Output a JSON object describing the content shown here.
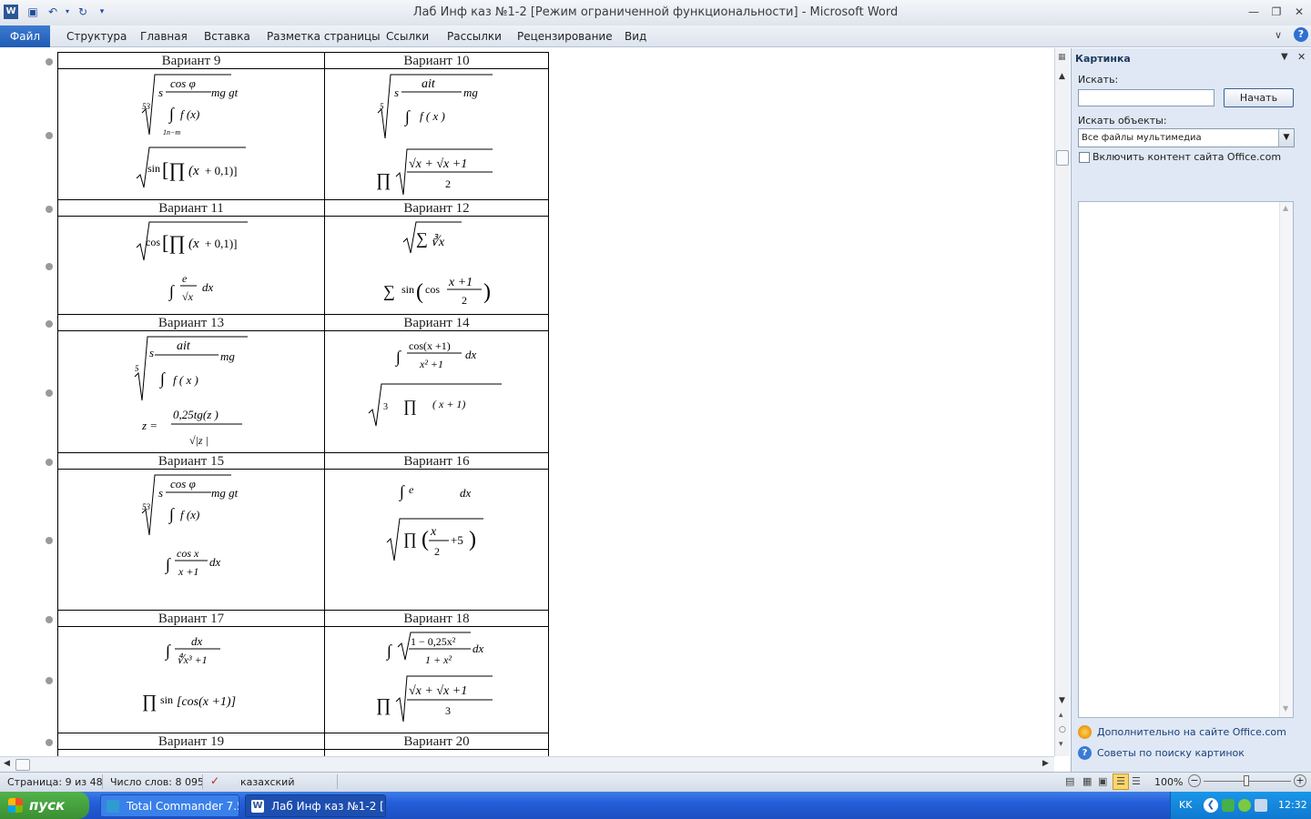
{
  "window": {
    "title": "Лаб Инф каз №1-2 [Режим ограниченной функциональности]  -  Microsoft Word",
    "app_icon": "word-icon"
  },
  "quick_access": [
    "save-icon",
    "undo-icon",
    "redo-icon",
    "customize-icon"
  ],
  "ribbon": {
    "file": "Файл",
    "tabs": [
      "Структура",
      "Главная",
      "Вставка",
      "Разметка страницы",
      "Ссылки",
      "Рассылки",
      "Рецензирование",
      "Вид"
    ]
  },
  "document": {
    "variants": [
      {
        "left": "Вариант   9",
        "right": "Вариант   10"
      },
      {
        "left": "Вариант   11",
        "right": "Вариант   12"
      },
      {
        "left": "Вариант   13",
        "right": "Вариант   14"
      },
      {
        "left": "Вариант   15",
        "right": "Вариант   16"
      },
      {
        "left": "Вариант   17",
        "right": "Вариант   18"
      },
      {
        "left": "Вариант   19",
        "right": "Вариант   20"
      }
    ]
  },
  "pane": {
    "title": "Картинка",
    "search_label": "Искать:",
    "search_value": "",
    "start_button": "Начать",
    "objects_label": "Искать объекты:",
    "objects_value": "Все файлы мультимедиа",
    "include_checkbox": "Включить контент сайта Office.com",
    "include_checked": false,
    "link_more": "Дополнительно на сайте Office.com",
    "link_tips": "Советы по поиску картинок"
  },
  "status": {
    "page": "Страница: 9 из 48",
    "words": "Число слов: 8 095",
    "language": "казахский",
    "zoom": "100%"
  },
  "taskbar": {
    "start": "пуск",
    "tasks": [
      "Total Commander 7.5...",
      "Лаб Инф каз №1-2 [..."
    ],
    "lang": "KK",
    "time": "12:32"
  }
}
